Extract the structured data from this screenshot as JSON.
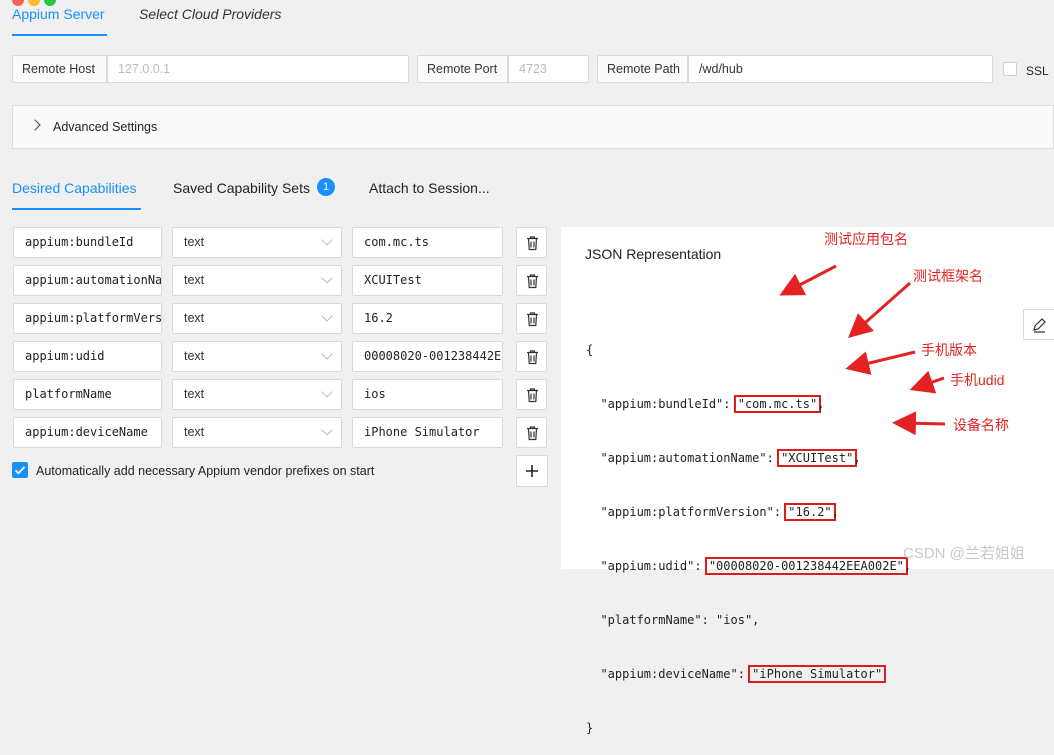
{
  "top_tabs": [
    {
      "label": "Appium Server",
      "active": true
    },
    {
      "label": "Select Cloud Providers",
      "active": false
    }
  ],
  "server": {
    "remote_host_label": "Remote Host",
    "remote_host_placeholder": "127.0.0.1",
    "remote_port_label": "Remote Port",
    "remote_port_placeholder": "4723",
    "remote_path_label": "Remote Path",
    "remote_path_value": "/wd/hub",
    "ssl_label": "SSL"
  },
  "advanced_settings_label": "Advanced Settings",
  "cap_tabs": [
    {
      "label": "Desired Capabilities",
      "active": true
    },
    {
      "label": "Saved Capability Sets",
      "badge": "1"
    },
    {
      "label": "Attach to Session..."
    }
  ],
  "capabilities": [
    {
      "name": "appium:bundleId",
      "type": "text",
      "value": "com.mc.ts"
    },
    {
      "name": "appium:automationName",
      "type": "text",
      "value": "XCUITest"
    },
    {
      "name": "appium:platformVersion",
      "type": "text",
      "value": "16.2"
    },
    {
      "name": "appium:udid",
      "type": "text",
      "value": "00008020-001238442EEA002E"
    },
    {
      "name": "platformName",
      "type": "text",
      "value": "ios"
    },
    {
      "name": "appium:deviceName",
      "type": "text",
      "value": "iPhone Simulator"
    }
  ],
  "auto_prefix_label": "Automatically add necessary Appium vendor prefixes on start",
  "auto_prefix_checked": true,
  "json_panel": {
    "title": "JSON Representation",
    "open_brace": "{",
    "close_brace": "}",
    "lines": [
      {
        "key": "\"appium:bundleId\": ",
        "value": "\"com.mc.ts\"",
        "trail": ",",
        "highlight": true
      },
      {
        "key": "\"appium:automationName\": ",
        "value": "\"XCUITest\"",
        "trail": ",",
        "highlight": true
      },
      {
        "key": "\"appium:platformVersion\": ",
        "value": "\"16.2\"",
        "trail": ",",
        "highlight": true
      },
      {
        "key": "\"appium:udid\": ",
        "value": "\"00008020-001238442EEA002E\"",
        "trail": ",",
        "highlight": true
      },
      {
        "key": "\"platformName\": ",
        "value": "\"ios\"",
        "trail": ",",
        "highlight": false
      },
      {
        "key": "\"appium:deviceName\": ",
        "value": "\"iPhone Simulator\"",
        "trail": "",
        "highlight": true
      }
    ]
  },
  "annotations": {
    "bundle": "测试应用包名",
    "automation": "测试框架名",
    "version": "手机版本",
    "udid": "手机udid",
    "device": "设备名称"
  },
  "watermark": "CSDN @兰若姐姐",
  "colors": {
    "accent": "#1890ff",
    "annotation": "#e52222",
    "checkbox": "#1890ff"
  }
}
